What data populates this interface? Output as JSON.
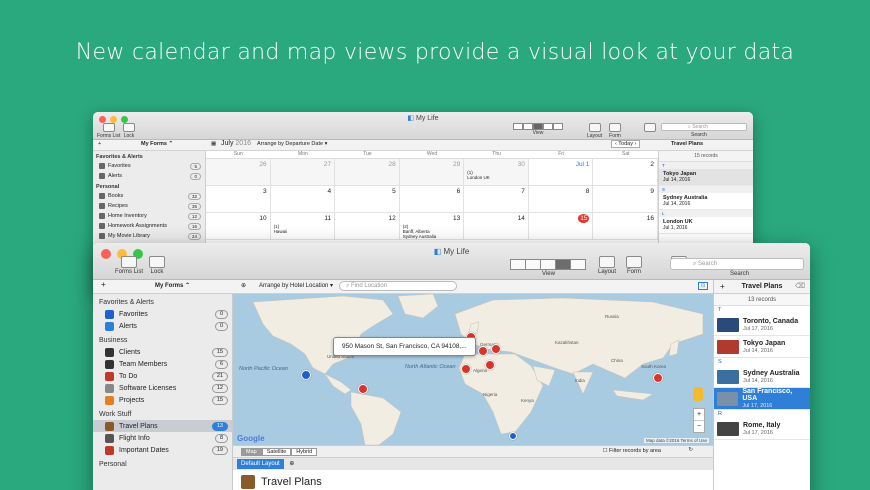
{
  "headline": "New calendar and map views provide a visual look at your data",
  "back_window": {
    "title": "My Life",
    "toolbar": {
      "forms_list": "Forms List",
      "lock": "Lock",
      "view": "View",
      "layout": "Layout",
      "form": "Form",
      "search": "Search",
      "search_placeholder": "Search"
    },
    "my_forms": "My Forms ⌃",
    "month": "July",
    "year": "2016",
    "arrange": "Arrange by Departure Date ▾",
    "today": "Today",
    "panel_title": "Travel Plans",
    "records": "15 records",
    "days": [
      "Sun",
      "Mon",
      "Tue",
      "Wed",
      "Thu",
      "Fri",
      "Sat"
    ],
    "weeks": [
      [
        {
          "d": "26",
          "dim": true
        },
        {
          "d": "27",
          "dim": true
        },
        {
          "d": "28",
          "dim": true
        },
        {
          "d": "29",
          "dim": true
        },
        {
          "d": "30",
          "dim": true,
          "ev": "(1)\nLondon UK"
        },
        {
          "d": "Jul 1"
        },
        {
          "d": "2"
        }
      ],
      [
        {
          "d": "3"
        },
        {
          "d": "4"
        },
        {
          "d": "5"
        },
        {
          "d": "6"
        },
        {
          "d": "7"
        },
        {
          "d": "8"
        },
        {
          "d": "9"
        }
      ],
      [
        {
          "d": "10"
        },
        {
          "d": "11",
          "ev": "(1)\nHawaii"
        },
        {
          "d": "12"
        },
        {
          "d": "13",
          "ev": "(2)\nBanff, Alberta\nSydney Australia"
        },
        {
          "d": "14"
        },
        {
          "d": "15"
        },
        {
          "d": "16"
        }
      ]
    ],
    "sidebar": [
      {
        "type": "hdr",
        "label": "Favorites & Alerts"
      },
      {
        "label": "Favorites",
        "badge": "5"
      },
      {
        "label": "Alerts",
        "badge": "0"
      },
      {
        "type": "hdr",
        "label": "Personal"
      },
      {
        "label": "Books",
        "badge": "32"
      },
      {
        "label": "Recipes",
        "badge": "35"
      },
      {
        "label": "Home Inventory",
        "badge": "12"
      },
      {
        "label": "Homework Assignments",
        "badge": "16"
      },
      {
        "label": "My Movie Library",
        "badge": "24"
      }
    ],
    "list": [
      {
        "sec": "T",
        "name": "Tokyo Japan",
        "date": "Jul 14, 2016"
      },
      {
        "sec": "S",
        "name": "Sydney Australia",
        "date": "Jul 14, 2016"
      },
      {
        "sec": "L",
        "name": "London UK",
        "date": "Jul 1, 2016"
      }
    ]
  },
  "front_window": {
    "title": "My Life",
    "toolbar": {
      "forms_list": "Forms List",
      "lock": "Lock",
      "view": "View",
      "layout": "Layout",
      "form": "Form",
      "search": "Search",
      "search_placeholder": "Search"
    },
    "my_forms": "My Forms ⌃",
    "arrange": "Arrange by Hotel Location ▾",
    "find_placeholder": "Find Location",
    "sidebar": [
      {
        "type": "hdr",
        "label": "Favorites & Alerts"
      },
      {
        "label": "Favorites",
        "badge": "0",
        "color": "#1f5fcf",
        "icon": "star-icon"
      },
      {
        "label": "Alerts",
        "badge": "0",
        "color": "#2f7fd8",
        "icon": "alarm-clock-icon"
      },
      {
        "type": "hdr",
        "label": "Business"
      },
      {
        "label": "Clients",
        "badge": "15",
        "color": "#333",
        "icon": "people-icon"
      },
      {
        "label": "Team Members",
        "badge": "6",
        "color": "#333",
        "icon": "people-icon"
      },
      {
        "label": "To Do",
        "badge": "21",
        "color": "#c0392b",
        "icon": "checklist-icon"
      },
      {
        "label": "Software Licenses",
        "badge": "12",
        "color": "#888",
        "icon": "key-icon"
      },
      {
        "label": "Projects",
        "badge": "15",
        "color": "#e67e22",
        "icon": "tools-icon"
      },
      {
        "type": "hdr",
        "label": "Work Stuff"
      },
      {
        "label": "Travel Plans",
        "badge": "13",
        "color": "#8b5a2b",
        "icon": "suitcase-icon",
        "selected": true
      },
      {
        "label": "Flight Info",
        "badge": "8",
        "color": "#555",
        "icon": "plane-icon"
      },
      {
        "label": "Important Dates",
        "badge": "19",
        "color": "#c0392b",
        "icon": "calendar-icon"
      },
      {
        "type": "hdr",
        "label": "Personal"
      }
    ],
    "map": {
      "popup": "950 Mason St, San Francisco, CA  94108,...",
      "labels": {
        "north_pacific": "North\nPacific\nOcean",
        "north_atlantic": "North\nAtlantic\nOcean",
        "united_states": "United States",
        "russia": "Russia",
        "kazakhstan": "Kazakhstan",
        "germany": "Germany",
        "china": "China",
        "south_korea": "South Korea",
        "india": "India",
        "algeria": "Algeria",
        "nigeria": "Nigeria",
        "kenya": "Kenya"
      },
      "google": "Google",
      "mapdata": "Map data ©2016  Terms of Use",
      "zoom_in": "+",
      "zoom_out": "−",
      "tabs": [
        "Map",
        "Satellite",
        "Hybrid"
      ],
      "filter": "Filter records by area"
    },
    "layout_label": "Default Layout",
    "form_title": "Travel Plans",
    "panel_title": "Travel Plans",
    "records": "13 records",
    "list": [
      {
        "sec": "T",
        "name": "Toronto, Canada",
        "date": "Jul 17, 2016",
        "color": "#2a4a7a"
      },
      {
        "name": "Tokyo Japan",
        "date": "Jul 14, 2016",
        "color": "#b03a2e"
      },
      {
        "sec": "S",
        "name": "Sydney Australia",
        "date": "Jul 14, 2016",
        "color": "#3a6fa0"
      },
      {
        "name": "San Francisco, USA",
        "date": "Jul 17, 2016",
        "color": "#7a8fa8",
        "selected": true
      },
      {
        "sec": "R",
        "name": "Rome, Italy",
        "date": "Jul 17, 2016",
        "color": "#444"
      }
    ]
  }
}
